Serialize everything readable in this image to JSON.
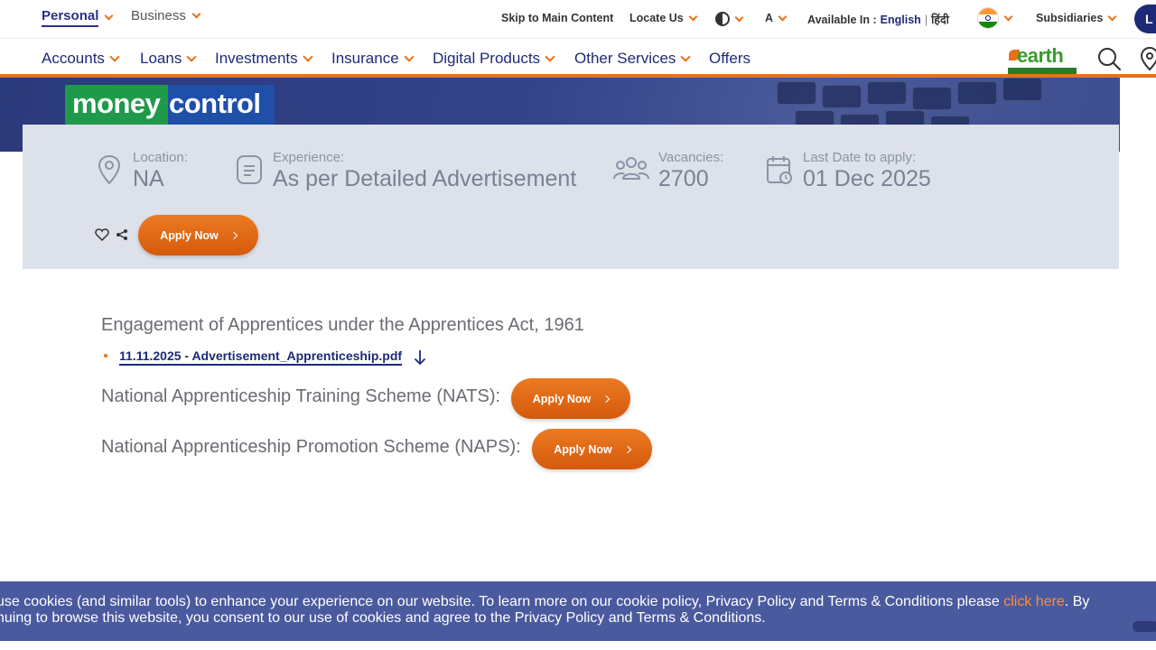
{
  "top": {
    "segments": [
      "Personal",
      "Business"
    ],
    "skip": "Skip to Main Content",
    "locate": "Locate Us",
    "font_label": "A",
    "available_label": "Available In :",
    "lang_english": "English",
    "lang_sep": "|",
    "lang_hindi": "हिंदी",
    "subsidiaries": "Subsidiaries",
    "login": "L"
  },
  "nav": {
    "items": [
      "Accounts",
      "Loans",
      "Investments",
      "Insurance",
      "Digital Products",
      "Other Services",
      "Offers"
    ],
    "earth_logo_text": "earth"
  },
  "banner": {
    "logo_part1": "money",
    "logo_part2": "control"
  },
  "job": {
    "location_label": "Location:",
    "location_value": "NA",
    "experience_label": "Experience:",
    "experience_value": "As per Detailed Advertisement",
    "vacancies_label": "Vacancies:",
    "vacancies_value": "2700",
    "last_date_label": "Last Date to apply:",
    "last_date_value": "01 Dec 2025",
    "apply_label": "Apply Now"
  },
  "content": {
    "title": "Engagement of Apprentices under the Apprentices Act, 1961",
    "pdf_link": "11.11.2025 - Advertisement_Apprenticeship.pdf",
    "nats_label": "National Apprenticeship Training Scheme (NATS):",
    "naps_label": "National Apprenticeship Promotion Scheme (NAPS):",
    "apply_label": "Apply Now"
  },
  "cookie": {
    "line1_start": "use cookies (and similar tools) to enhance your experience on our website. To learn more on our cookie policy, Privacy Policy and Terms & Conditions please ",
    "line1_link": "click here",
    "line1_end": ". By",
    "line2": "nuing to browse this website, you consent to our use of cookies and agree to the Privacy Policy and Terms & Conditions."
  },
  "colors": {
    "brand_blue": "#1e2a78",
    "accent_orange": "#e8711a",
    "card_grey": "#dde1ea",
    "cookie_bg": "#4a5a9e"
  }
}
